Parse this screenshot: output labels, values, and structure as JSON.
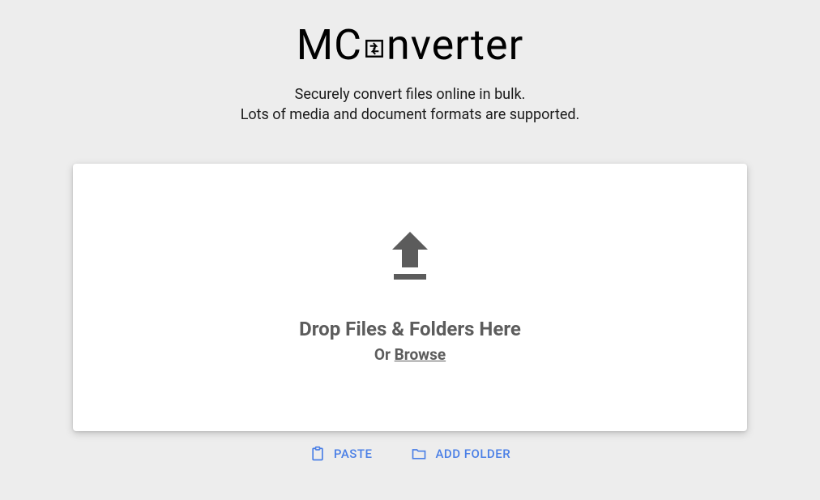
{
  "logo": {
    "prefix": "MC",
    "suffix": "nverter"
  },
  "tagline": {
    "line1": "Securely convert files online in bulk.",
    "line2": "Lots of media and document formats are supported."
  },
  "dropzone": {
    "title": "Drop Files & Folders Here",
    "or_text": "Or ",
    "browse": "Browse"
  },
  "actions": {
    "paste": "PASTE",
    "add_folder": "ADD FOLDER"
  },
  "colors": {
    "accent": "#4a7fe6",
    "muted": "#5c5c5c",
    "bg": "#ededed"
  }
}
